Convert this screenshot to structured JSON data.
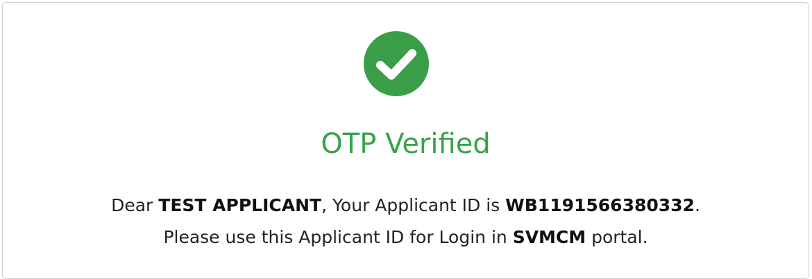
{
  "status": {
    "icon": "check-circle-icon",
    "icon_color": "#3a9e48",
    "title": "OTP Verified",
    "title_color": "#3aa24a"
  },
  "message": {
    "line1": {
      "prefix": "Dear ",
      "applicant_name": "TEST APPLICANT",
      "middle": ", Your Applicant ID is ",
      "applicant_id": "WB1191566380332",
      "suffix": "."
    },
    "line2": {
      "prefix": "Please use this Applicant ID for Login in ",
      "portal_name": "SVMCM",
      "suffix": " portal."
    }
  }
}
